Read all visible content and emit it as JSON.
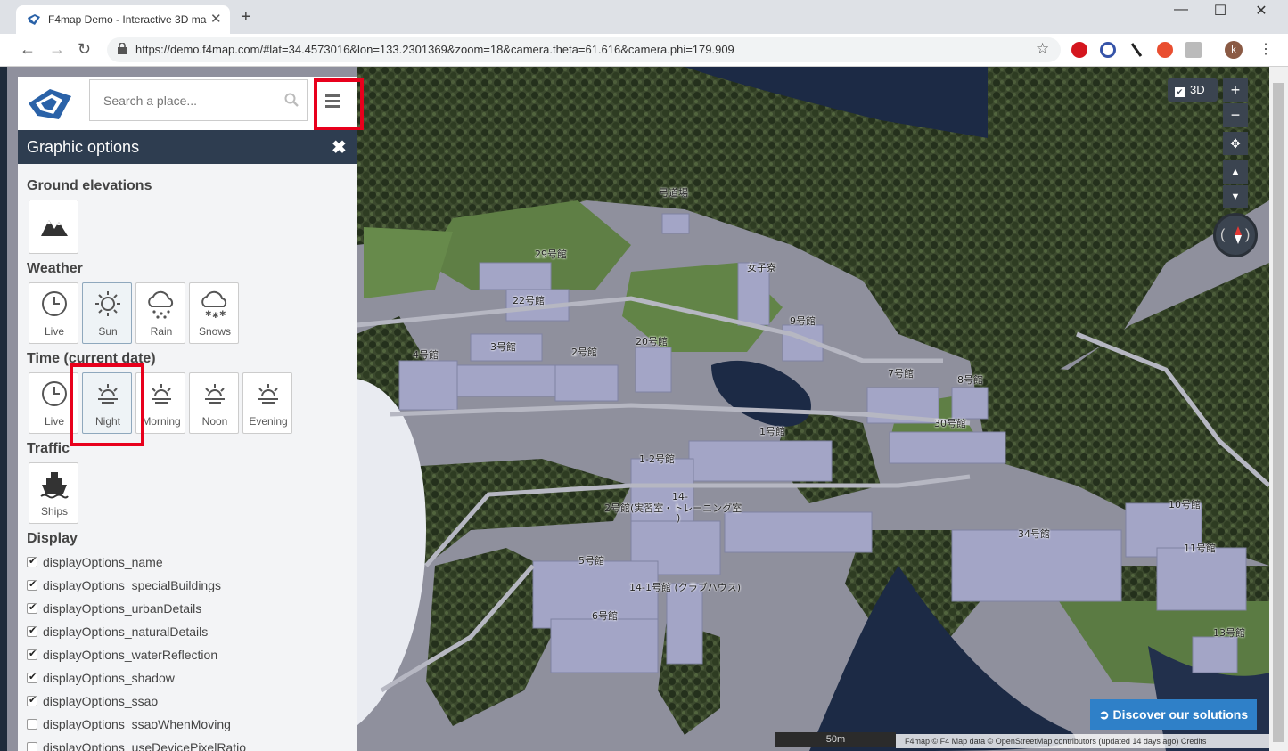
{
  "browser": {
    "tab_title": "F4map Demo - Interactive 3D ma",
    "url": "https://demo.f4map.com/#lat=34.4573016&lon=133.2301369&zoom=18&camera.theta=61.616&camera.phi=179.909",
    "new_tab": "+",
    "close_tab": "✕",
    "avatar_letter": "k"
  },
  "search": {
    "placeholder": "Search a place..."
  },
  "panel": {
    "title": "Graphic options",
    "close": "✖",
    "sections": {
      "ground": "Ground elevations",
      "weather": "Weather",
      "time": "Time (current date)",
      "traffic": "Traffic",
      "display": "Display"
    },
    "weather": [
      "Live",
      "Sun",
      "Rain",
      "Snows"
    ],
    "time": [
      "Live",
      "Night",
      "Morning",
      "Noon",
      "Evening"
    ],
    "traffic": [
      "Ships"
    ],
    "display_options": [
      {
        "label": "displayOptions_name",
        "checked": true
      },
      {
        "label": "displayOptions_specialBuildings",
        "checked": true
      },
      {
        "label": "displayOptions_urbanDetails",
        "checked": true
      },
      {
        "label": "displayOptions_naturalDetails",
        "checked": true
      },
      {
        "label": "displayOptions_waterReflection",
        "checked": true
      },
      {
        "label": "displayOptions_shadow",
        "checked": true
      },
      {
        "label": "displayOptions_ssao",
        "checked": true
      },
      {
        "label": "displayOptions_ssaoWhenMoving",
        "checked": false
      },
      {
        "label": "displayOptions_useDevicePixelRatio",
        "checked": false
      }
    ]
  },
  "map": {
    "toggle_3d": "3D",
    "zoom_in": "+",
    "zoom_out": "−",
    "discover": "Discover our solutions",
    "scale": "50m",
    "attribution": "F4map © F4    Map data © OpenStreetMap contributors (updated 14 days ago)    Credits",
    "labels": [
      "弓道場",
      "29号館",
      "女子寮",
      "22号館",
      "9号館",
      "3号館",
      "2号館",
      "20号館",
      "4号館",
      "7号館",
      "8号館",
      "30号館",
      "1号館",
      "1-2号館",
      "14-",
      "2号館(実習室・トレーニング室",
      ")",
      "10号館",
      "34号館",
      "11号館",
      "5号館",
      "14-1号館 (クラブハウス)",
      "6号館",
      "13号館"
    ]
  },
  "colors": {
    "panel_header": "#2e3d50",
    "highlight": "#e8001c",
    "discover": "#2f80c8",
    "forest": "#3c4a2e",
    "grass": "#5f7f45",
    "water": "#1c2a45",
    "building": "#a3a5c6"
  }
}
